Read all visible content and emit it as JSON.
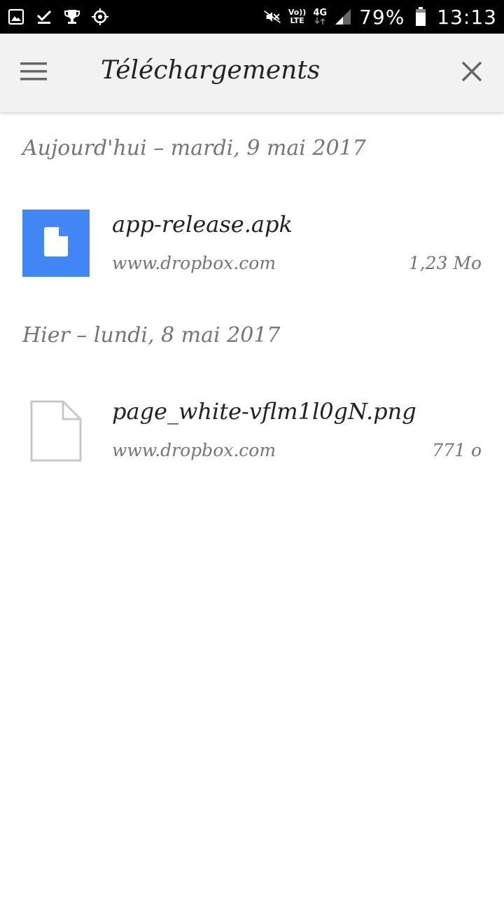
{
  "status_bar": {
    "battery_percent": "79%",
    "time": "13:13",
    "volte": "Vo))",
    "lte": "LTE",
    "network": "4G",
    "left_icons": [
      "gallery-icon",
      "download-done-icon",
      "trophy-icon",
      "crosshair-icon"
    ],
    "right_icons": [
      "mute-icon",
      "volte-icon",
      "network-4g-icon",
      "signal-icon",
      "battery-icon"
    ]
  },
  "app_bar": {
    "title": "Téléchargements",
    "menu_icon": "hamburger-menu-icon",
    "close_icon": "close-icon"
  },
  "sections": [
    {
      "header": "Aujourd'hui – mardi, 9 mai 2017",
      "items": [
        {
          "name": "app-release.apk",
          "source": "www.dropbox.com",
          "size": "1,23 Mo",
          "icon": "file-icon"
        }
      ]
    },
    {
      "header": "Hier – lundi, 8 mai 2017",
      "items": [
        {
          "name": "page_white-vflm1l0gN.png",
          "source": "www.dropbox.com",
          "size": "771 o",
          "icon": "blank-page-icon"
        }
      ]
    }
  ],
  "colors": {
    "status_bar": "#000000",
    "app_bar": "#f2f2f2",
    "apk_thumb": "#4285f4",
    "primary_text": "#222222",
    "secondary_text": "#757575"
  }
}
